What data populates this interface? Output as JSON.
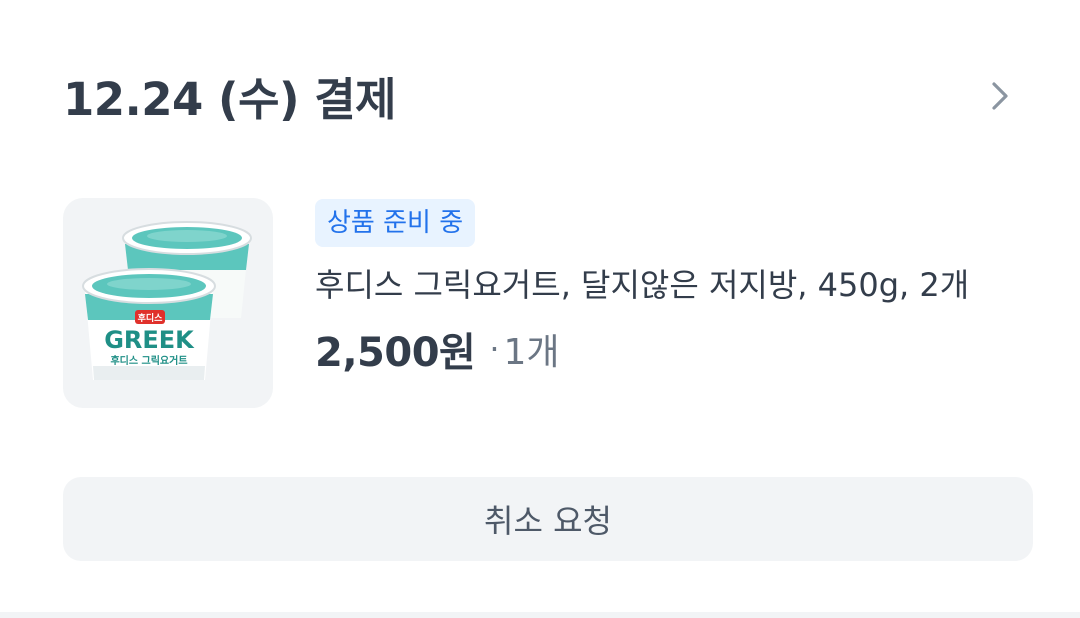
{
  "order": {
    "date_title": "12.24 (수) 결제",
    "chevron_icon": "chevron-right-icon"
  },
  "item": {
    "status": "상품 준비 중",
    "name": "후디스 그릭요거트, 달지않은 저지방, 450g, 2개",
    "price": "2,500원",
    "separator": "·",
    "quantity": "1개",
    "image": {
      "brand_label": "후디스",
      "product_label": "GREEK",
      "sub_label": "후디스 그릭요거트"
    }
  },
  "actions": {
    "cancel_label": "취소 요청"
  },
  "colors": {
    "text_primary": "#333d4b",
    "text_secondary": "#6b7684",
    "badge_bg": "#e8f3ff",
    "badge_text": "#2272eb",
    "button_bg": "#f2f4f6",
    "thumb_bg": "#f2f4f6",
    "yogurt_teal": "#5cc6bd"
  }
}
